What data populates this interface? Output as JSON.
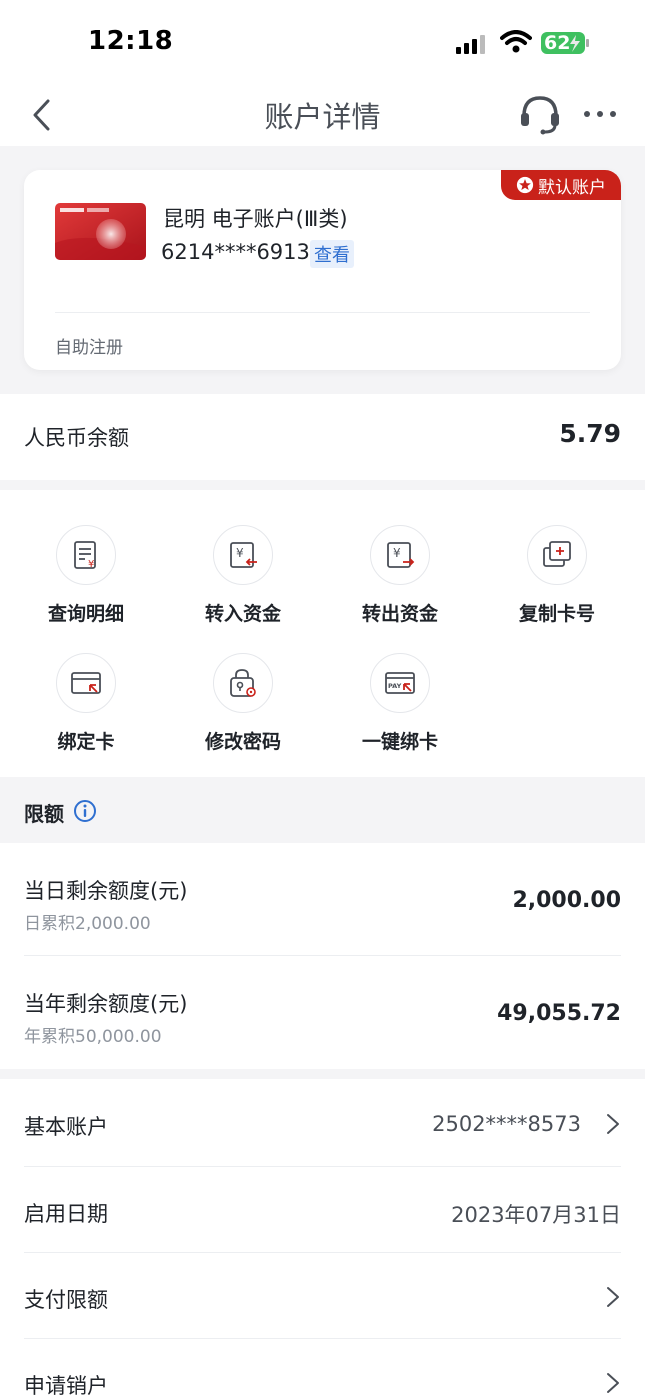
{
  "status_bar": {
    "time": "12:18",
    "battery": "62"
  },
  "nav": {
    "title": "账户详情"
  },
  "card": {
    "badge": "默认账户",
    "name": "昆明 电子账户(Ⅲ类)",
    "number": "6214****6913",
    "view_label": "查看",
    "footer": "自助注册"
  },
  "balance": {
    "label": "人民币余额",
    "value": "5.79"
  },
  "actions": [
    {
      "label": "查询明细",
      "icon": "statement-icon"
    },
    {
      "label": "转入资金",
      "icon": "transfer-in-icon"
    },
    {
      "label": "转出资金",
      "icon": "transfer-out-icon"
    },
    {
      "label": "复制卡号",
      "icon": "copy-card-icon"
    },
    {
      "label": "绑定卡",
      "icon": "bind-card-icon"
    },
    {
      "label": "修改密码",
      "icon": "change-password-icon"
    },
    {
      "label": "一键绑卡",
      "icon": "quick-bind-icon"
    }
  ],
  "limits": {
    "title": "限额",
    "daily": {
      "label": "当日剩余额度(元)",
      "sub": "日累积2,000.00",
      "value": "2,000.00"
    },
    "yearly": {
      "label": "当年剩余额度(元)",
      "sub": "年累积50,000.00",
      "value": "49,055.72"
    }
  },
  "info": [
    {
      "label": "基本账户",
      "value": "2502****8573"
    },
    {
      "label": "启用日期",
      "value": "2023年07月31日"
    },
    {
      "label": "支付限额",
      "value": ""
    },
    {
      "label": "申请销户",
      "value": ""
    }
  ],
  "colors": {
    "accent_red": "#c9221a",
    "link_blue": "#2f6fd0"
  }
}
